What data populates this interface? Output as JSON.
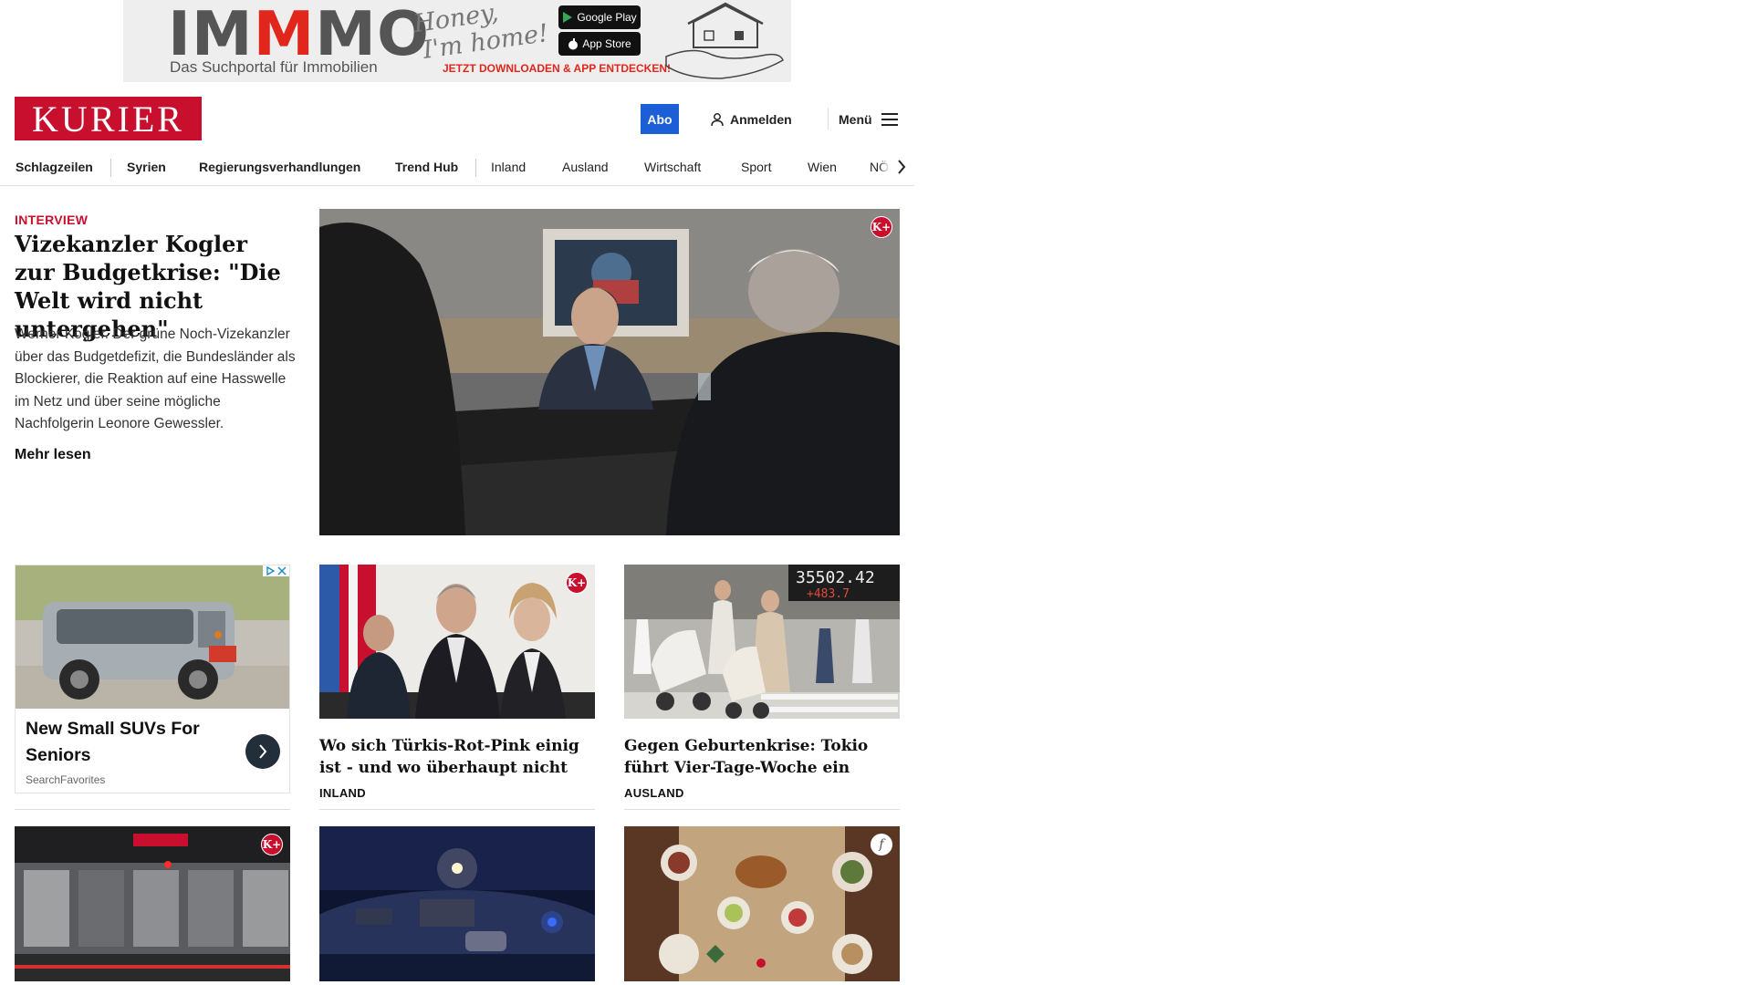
{
  "ad_banner": {
    "brand_prefix": "IM",
    "brand_highlight": "M",
    "brand_suffix": "MO",
    "tagline": "Das Suchportal für Immobilien",
    "script_line1": "Honey,",
    "script_line2": "I'm home!",
    "store_google": "Google Play",
    "store_apple": "App Store",
    "cta": "JETZT DOWNLOADEN & APP ENTDECKEN!"
  },
  "header": {
    "logo_text": "KURIER",
    "abo_label": "Abo",
    "login_label": "Anmelden",
    "menu_label": "Menü"
  },
  "nav": {
    "items": [
      "Schlagzeilen",
      "Syrien",
      "Regierungsverhandlungen",
      "Trend Hub",
      "Inland",
      "Ausland",
      "Wirtschaft",
      "Sport",
      "Wien",
      "NÖ"
    ]
  },
  "lead": {
    "kicker": "INTERVIEW",
    "title": "Vizekanzler Kogler zur Budgetkrise: \"Die Welt wird nicht untergehen\"",
    "teaser": "Werner Kogler. Der grüne Noch-Vizekanzler über das Budgetdefizit, die Bundesländer als Blockierer, die Reaktion auf eine Hasswelle im Netz und über seine mögliche Nachfolgerin Leonore Gewessler.",
    "more_label": "Mehr lesen",
    "badge": "K+"
  },
  "sponsored": {
    "title": "New Small SUVs For Seniors",
    "source": "SearchFavorites"
  },
  "cards": [
    {
      "title": "Wo sich Türkis-Rot-Pink einig ist - und wo überhaupt nicht",
      "section": "INLAND",
      "badge": "K+"
    },
    {
      "title": "Gegen Geburtenkrise: Tokio führt Vier-Tage-Woche ein",
      "section": "AUSLAND",
      "ticker": "35502.42",
      "ticker_change": "+483.7"
    }
  ],
  "bottom_cards": [
    {
      "badge": "K+"
    },
    {},
    {
      "badge": "f"
    }
  ],
  "colors": {
    "brand_red": "#c8102e",
    "abo_blue": "#1b5ed6"
  }
}
